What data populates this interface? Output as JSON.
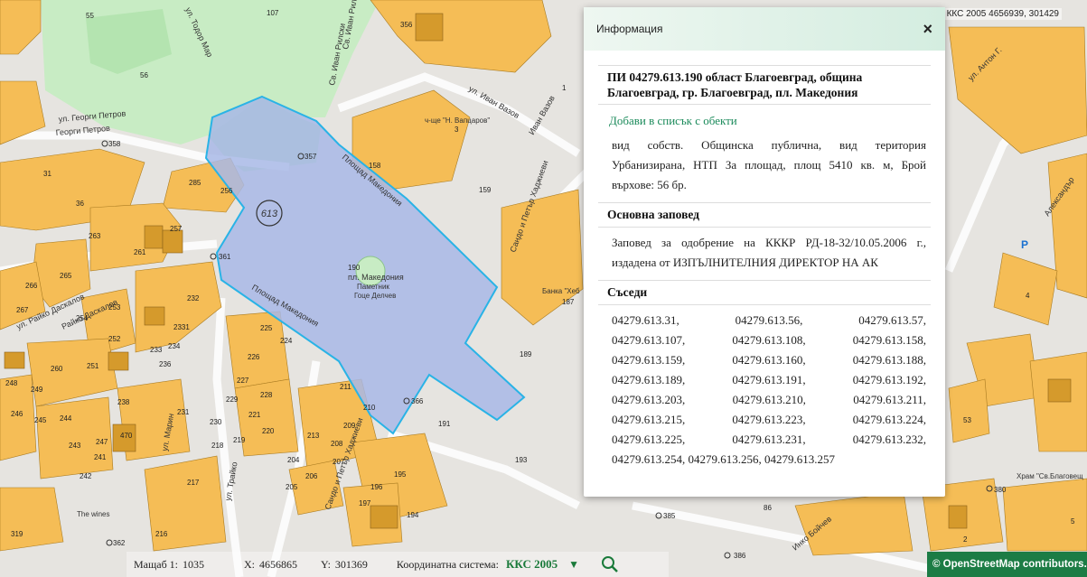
{
  "map": {
    "coordinate_readout": "ККС 2005 4656939, 301429",
    "streets": [
      "ул. Тодор Мар",
      "ул. Георги Петров",
      "Георги Петров",
      "Св. Иван Рилски",
      "Св. Иван Рилски",
      "ул. Иван Вазов",
      "Иван Вазов",
      "Площад Македония",
      "Площад Македония",
      "Сандо и Петър Хаджиеви",
      "Сандо и Петър Хаджиеви",
      "ул. Райко Даскалов",
      "Райко Даскалов",
      "ул. Антон Г.",
      "Александър",
      "ул. Марин",
      "ул. Трайко",
      "Инко Бойчев"
    ],
    "parcel_numbers": [
      "55",
      "56",
      "107",
      "356",
      "358",
      "357",
      "613",
      "361",
      "366",
      "190",
      "159",
      "189",
      "191",
      "193",
      "187",
      "158",
      "3",
      "1",
      "31",
      "36",
      "285",
      "256",
      "263",
      "265",
      "266",
      "267",
      "252",
      "253",
      "254",
      "260",
      "251",
      "248",
      "249",
      "246",
      "245",
      "244",
      "243",
      "242",
      "241",
      "247",
      "238",
      "233",
      "236",
      "234",
      "232",
      "231",
      "230",
      "229",
      "226",
      "225",
      "224",
      "227",
      "228",
      "221",
      "219",
      "218",
      "217",
      "216",
      "211",
      "210",
      "209",
      "208",
      "207",
      "206",
      "205",
      "204",
      "195",
      "196",
      "197",
      "194",
      "362",
      "319",
      "380",
      "385",
      "386",
      "53",
      "4",
      "5",
      "2",
      "257",
      "261",
      "470",
      "213",
      "220",
      "2331",
      "86"
    ],
    "place_labels": [
      "ч-ще \"Н. Вапцаров\"",
      "пл. Македония",
      "Паметник",
      "Гоце Делчев",
      "Храм \"Св.Благовещ",
      "Банка \"Хеб",
      "The wines"
    ],
    "cadastre_number": "613"
  },
  "info_panel": {
    "title": "Информация",
    "close_glyph": "×",
    "parcel_heading": "ПИ 04279.613.190 област Благоевград, община Благоевград, гр. Благоевград, пл. Македония",
    "add_link": "Добави в списък с обекти",
    "property_text": "вид собств. Общинска публична, вид територия Урбанизирана, НТП За площад, площ 5410 кв. м, Брой върхове: 56 бр.",
    "order_heading": "Основна заповед",
    "order_text": "Заповед за одобрение на КККР РД-18-32/10.05.2006 г., издадена от ИЗПЪЛНИТЕЛНИЯ ДИРЕКТОР НА АК",
    "neighbors_heading": "Съседи",
    "neighbors": [
      [
        "04279.613.31,",
        "04279.613.56,",
        "04279.613.57,"
      ],
      [
        "04279.613.107,",
        "04279.613.108,",
        "04279.613.158,"
      ],
      [
        "04279.613.159,",
        "04279.613.160,",
        "04279.613.188,"
      ],
      [
        "04279.613.189,",
        "04279.613.191,",
        "04279.613.192,"
      ],
      [
        "04279.613.203,",
        "04279.613.210,",
        "04279.613.211,"
      ],
      [
        "04279.613.215,",
        "04279.613.223,",
        "04279.613.224,"
      ],
      [
        "04279.613.225,",
        "04279.613.231,",
        "04279.613.232,"
      ]
    ],
    "neighbors_last": "04279.613.254, 04279.613.256, 04279.613.257"
  },
  "status_bar": {
    "scale_label": "Мащаб 1:",
    "scale_value": "1035",
    "x_label": "X:",
    "x_value": "4656865",
    "y_label": "Y:",
    "y_value": "301369",
    "crs_label": "Координатна система:",
    "crs_value": "ККС 2005"
  },
  "attribution": "© OpenStreetMap contributors.",
  "colors": {
    "building": "#f5bd56",
    "building_dark": "#d59a2c",
    "park": "#c8ecc4",
    "selected_fill": "#a8b8e6",
    "selected_stroke": "#29b3e6",
    "accent_green": "#1c7c45"
  }
}
